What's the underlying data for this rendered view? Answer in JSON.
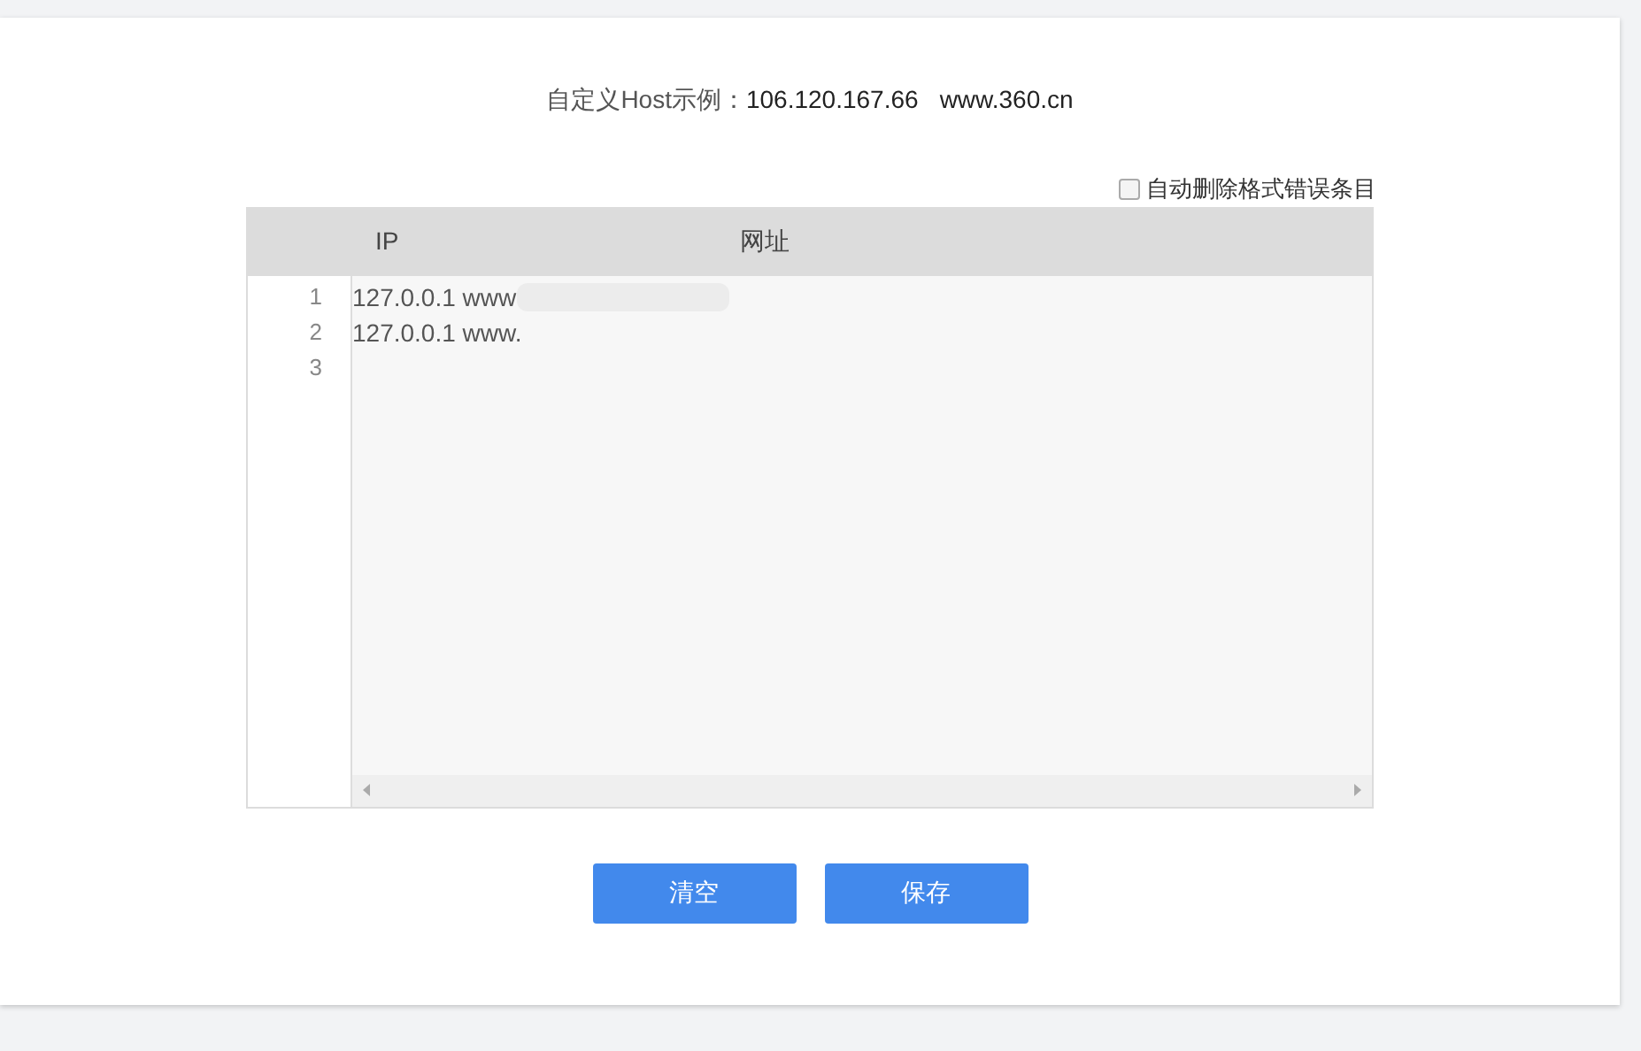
{
  "example": {
    "label": "自定义Host示例：",
    "ip": "106.120.167.66",
    "domain": "www.360.cn"
  },
  "auto_delete": {
    "label": "自动删除格式错误条目",
    "checked": false
  },
  "table": {
    "columns": [
      "IP",
      "网址"
    ],
    "lines": [
      {
        "number": "1",
        "text": "127.0.0.1 www",
        "redacted": true
      },
      {
        "number": "2",
        "text": "127.0.0.1 www.",
        "redacted": false
      },
      {
        "number": "3",
        "redacted": false
      }
    ]
  },
  "buttons": [
    "清空",
    "保存"
  ]
}
